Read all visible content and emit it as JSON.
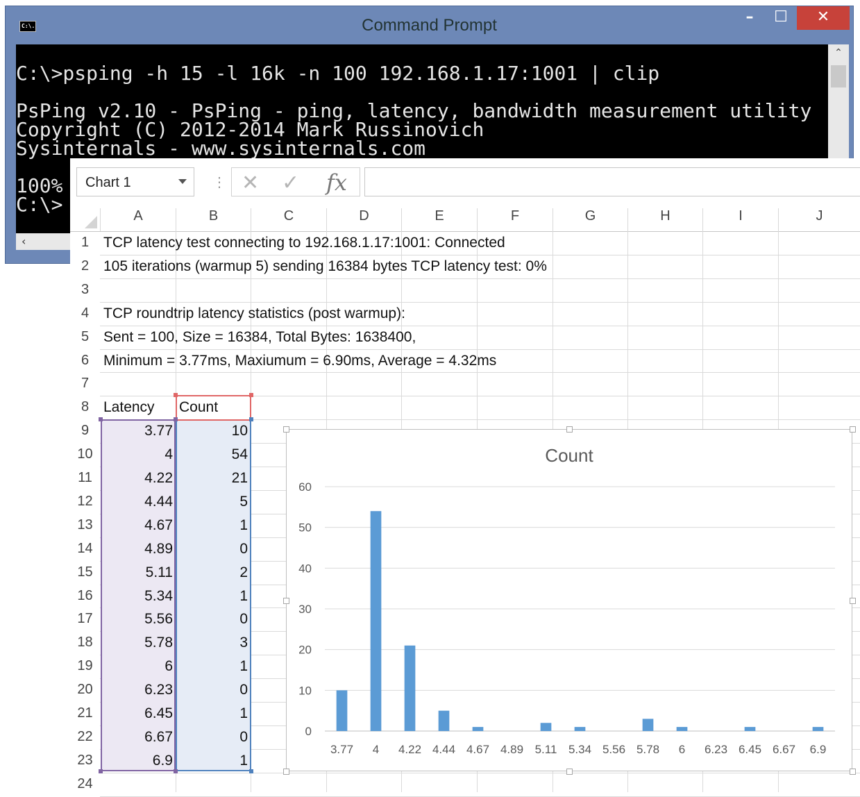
{
  "window": {
    "title": "Command Prompt",
    "icon": "cmd-icon",
    "icon_text": "C:\\.",
    "minimize": "–",
    "maximize": "☐",
    "close": "✕"
  },
  "console": {
    "command_line": "C:\\>psping -h 15 -l 16k -n 100 192.168.1.17:1001 | clip",
    "banner": "PsPing v2.10 - PsPing - ping, latency, bandwidth measurement utility\nCopyright (C) 2012-2014 Mark Russinovich\nSysinternals - www.sysinternals.com",
    "prompt": "100%\nC:\\>"
  },
  "excel": {
    "name_box": "Chart 1",
    "formula_cancel": "✕",
    "formula_enter": "✓",
    "formula_fx": "fx",
    "formula_value": "",
    "columns": [
      "A",
      "B",
      "C",
      "D",
      "E",
      "F",
      "G",
      "H",
      "I",
      "J"
    ],
    "rows": [
      "1",
      "2",
      "3",
      "4",
      "5",
      "6",
      "7",
      "8",
      "9",
      "10",
      "11",
      "12",
      "13",
      "14",
      "15",
      "16",
      "17",
      "18",
      "19",
      "20",
      "21",
      "22",
      "23",
      "24"
    ],
    "text_rows": {
      "r1": "TCP latency test connecting to 192.168.1.17:1001: Connected",
      "r2": "105 iterations (warmup 5) sending 16384 bytes TCP latency test:  0%",
      "r4": "TCP roundtrip latency statistics (post warmup):",
      "r5": "  Sent = 100, Size = 16384, Total Bytes: 1638400,",
      "r6": "  Minimum = 3.77ms, Maxiumum = 6.90ms, Average = 4.32ms"
    },
    "table_headers": [
      "Latency",
      "Count"
    ],
    "latency": [
      "3.77",
      "4",
      "4.22",
      "4.44",
      "4.67",
      "4.89",
      "5.11",
      "5.34",
      "5.56",
      "5.78",
      "6",
      "6.23",
      "6.45",
      "6.67",
      "6.9"
    ],
    "count": [
      "10",
      "54",
      "21",
      "5",
      "1",
      "0",
      "2",
      "1",
      "0",
      "3",
      "1",
      "0",
      "1",
      "0",
      "1"
    ]
  },
  "chart_data": {
    "type": "bar",
    "title": "Count",
    "categories": [
      "3.77",
      "4",
      "4.22",
      "4.44",
      "4.67",
      "4.89",
      "5.11",
      "5.34",
      "5.56",
      "5.78",
      "6",
      "6.23",
      "6.45",
      "6.67",
      "6.9"
    ],
    "values": [
      10,
      54,
      21,
      5,
      1,
      0,
      2,
      1,
      0,
      3,
      1,
      0,
      1,
      0,
      1
    ],
    "ylim": [
      0,
      60
    ],
    "yticks": [
      0,
      10,
      20,
      30,
      40,
      50,
      60
    ],
    "grid": true,
    "legend": "none",
    "bar_color": "#5b9bd5"
  }
}
